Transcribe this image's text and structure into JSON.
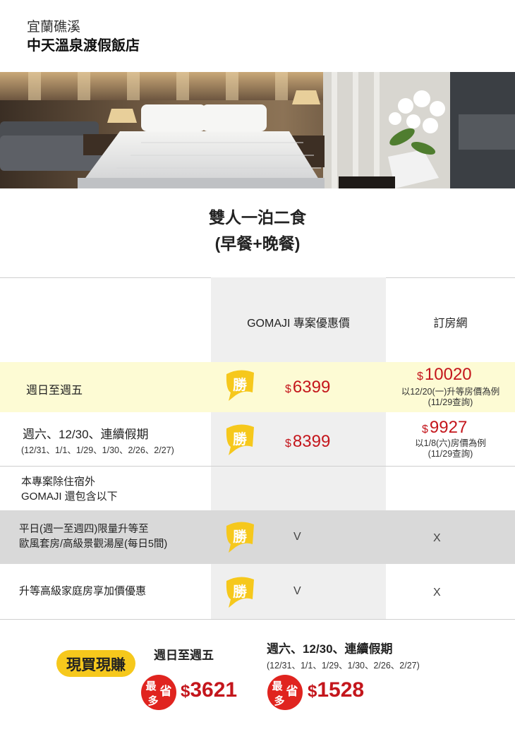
{
  "header": {
    "location": "宜蘭礁溪",
    "hotel_name": "中天溫泉渡假飯店"
  },
  "hero_image": "hotel-room-photo",
  "plan": {
    "line1": "雙人一泊二食",
    "line2": "(早餐+晚餐)"
  },
  "table": {
    "col_gomaji": "GOMAJI 專案優惠價",
    "col_booking": "訂房網",
    "badge_label": "勝",
    "currency": "$",
    "rows": [
      {
        "label": "週日至週五",
        "gomaji_price": "6399",
        "booking_price": "10020",
        "booking_note1": "以12/20(一)升等房價為例",
        "booking_note2": "(11/29查詢)"
      },
      {
        "label": "週六、12/30、連續假期",
        "sublabel": "(12/31、1/1、1/29、1/30、2/26、2/27)",
        "gomaji_price": "8399",
        "booking_price": "9927",
        "booking_note1": "以1/8(六)房價為例",
        "booking_note2": "(11/29查詢)"
      }
    ],
    "extra_title1": "本專案除住宿外",
    "extra_title2": "GOMAJI 還包含以下",
    "perks": [
      {
        "line1": "平日(週一至週四)限量升等至",
        "line2": "歐風套房/高級景觀湯屋(每日5間)",
        "gomaji": "V",
        "booking": "X"
      },
      {
        "line1": "升等高級家庭房享加價優惠",
        "gomaji": "V",
        "booking": "X"
      }
    ]
  },
  "footer": {
    "tag": "現買現賺",
    "weekday_label": "週日至週五",
    "weekend_label": "週六、12/30、連續假期",
    "weekend_sub": "(12/31、1/1、1/29、1/30、2/26、2/27)",
    "circle_top": "最",
    "circle_mid": "省",
    "circle_bottom": "多",
    "weekday_save": "3621",
    "weekend_save": "1528",
    "currency": "$"
  },
  "colors": {
    "highlight_row": "#fdfbd4",
    "gray_row": "#d9d9d9",
    "gomaji_col": "#efefef",
    "price_red": "#c4161c",
    "badge_yellow": "#f6c81c",
    "badge_red": "#e0241f"
  }
}
